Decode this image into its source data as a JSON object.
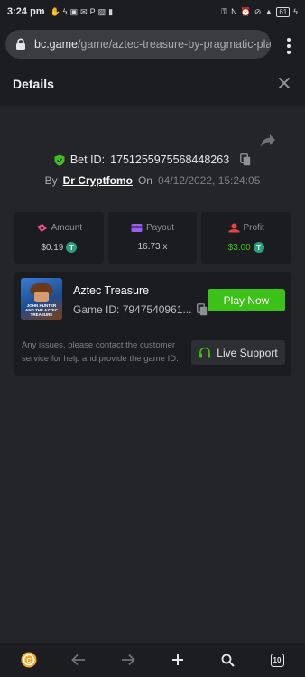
{
  "status_bar": {
    "time": "3:24 pm",
    "battery": "61"
  },
  "browser": {
    "url_host": "bc.game",
    "url_path": "/game/aztec-treasure-by-pragmatic-play",
    "tabs_count": "10"
  },
  "header": {
    "title": "Details"
  },
  "bet": {
    "id_label": "Bet ID:",
    "id_value": "1751255975568448263",
    "by_label": "By",
    "user": "Dr Cryptfomo",
    "on_label": "On",
    "date": "04/12/2022, 15:24:05"
  },
  "stats": [
    {
      "label": "Amount",
      "value": "$0.19",
      "icon": "amount-icon",
      "coin": true
    },
    {
      "label": "Payout",
      "value": "16.73 x",
      "icon": "payout-icon",
      "coin": false
    },
    {
      "label": "Profit",
      "value": "$3.00",
      "icon": "profit-icon",
      "coin": true
    }
  ],
  "game": {
    "name": "Aztec Treasure",
    "id_label": "Game ID:",
    "id_value": "7947540961...",
    "thumb_text": "JOHN HUNTER AND THE AZTEC TREASURE",
    "play_label": "Play Now",
    "info": "Any issues, please contact the customer service for help and provide the game ID.",
    "support_label": "Live Support"
  },
  "colors": {
    "accent": "#3bc117",
    "tether": "#26a17b",
    "background": "#232528",
    "panel": "#1b1c1f"
  }
}
